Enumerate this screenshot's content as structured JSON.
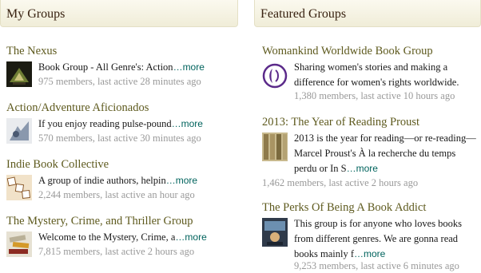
{
  "my_groups": {
    "heading": "My Groups",
    "groups": [
      {
        "title": "The Nexus",
        "desc": "Book Group - All Genre's: Action",
        "more": "…more",
        "meta": "975 members, last active 28 minutes ago",
        "icon": "book-group-thumbnail"
      },
      {
        "title": "Action/Adventure Aficionados",
        "desc": "If you enjoy reading pulse-pound",
        "more": "…more",
        "meta": "570 members, last active 30 minutes ago",
        "icon": "book-group-thumbnail"
      },
      {
        "title": "Indie Book Collective",
        "desc": "A group of indie authors, helpin",
        "more": "…more",
        "meta": "2,244 members, last active an hour ago",
        "icon": "book-group-thumbnail"
      },
      {
        "title": "The Mystery, Crime, and Thriller Group",
        "desc": "Welcome to the Mystery, Crime, a",
        "more": "…more",
        "meta": "7,815 members, last active 2 hours ago",
        "icon": "book-group-thumbnail"
      }
    ]
  },
  "featured_groups": {
    "heading": "Featured Groups",
    "groups": [
      {
        "title": "Womankind Worldwide Book Group",
        "desc": "Sharing women's stories and making a difference for women's rights worldwide.",
        "more": "",
        "meta": "1,380 members, last active 10 hours ago",
        "icon": "womankind-logo"
      },
      {
        "title": "2013: The Year of Reading Proust",
        "desc": "2013 is the year for reading—or re-reading—Marcel Proust's À la recherche du temps perdu or In S",
        "more": "…more",
        "meta": "1,462 members, last active 2 hours ago",
        "icon": "book-spines-thumbnail"
      },
      {
        "title": "The Perks Of Being A Book Addict",
        "desc": "This group is for anyone who loves books from different genres. We are gonna read books mainly f",
        "more": "…more",
        "meta": "9,253 members, last active 6 minutes ago",
        "icon": "book-group-thumbnail"
      }
    ]
  },
  "colors": {
    "title": "#5e5a1e",
    "more_link": "#00635d",
    "meta": "#999999",
    "header_text": "#382110"
  }
}
